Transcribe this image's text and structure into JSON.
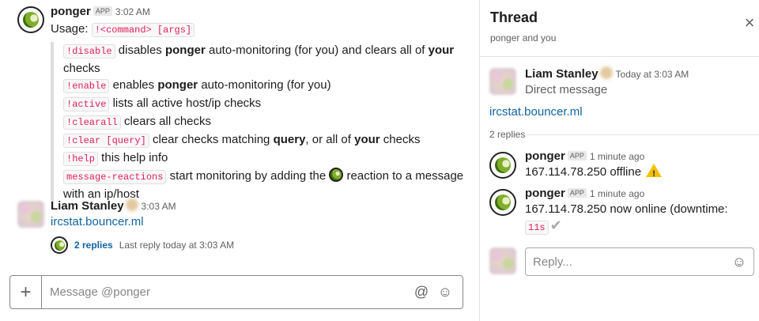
{
  "main": {
    "bot_message": {
      "author": "ponger",
      "badge": "APP",
      "time": "3:02 AM",
      "usage_label": "Usage:",
      "usage_code": "!<command> [args]",
      "commands": [
        {
          "code": "!disable",
          "pre": " disables ",
          "bold1": "ponger",
          "mid": " auto-monitoring (for you) and clears all of ",
          "bold2": "your",
          "post": " checks"
        },
        {
          "code": "!enable",
          "pre": " enables ",
          "bold1": "ponger",
          "mid": " auto-monitoring (for you)",
          "bold2": "",
          "post": ""
        },
        {
          "code": "!active",
          "pre": " lists all active host/ip checks",
          "bold1": "",
          "mid": "",
          "bold2": "",
          "post": ""
        },
        {
          "code": "!clearall",
          "pre": " clears all checks",
          "bold1": "",
          "mid": "",
          "bold2": "",
          "post": ""
        },
        {
          "code": "!clear [query]",
          "pre": " clear checks matching ",
          "bold1": "query",
          "mid": ", or all of ",
          "bold2": "your",
          "post": " checks"
        },
        {
          "code": "!help",
          "pre": " this help info",
          "bold1": "",
          "mid": "",
          "bold2": "",
          "post": ""
        }
      ],
      "reaction_code": "message-reactions",
      "reaction_pre": " start monitoring by adding the ",
      "reaction_post": " reaction to a message with an ip/host"
    },
    "user_message": {
      "author": "Liam Stanley",
      "time": "3:03 AM",
      "link": "ircstat.bouncer.ml"
    },
    "replies": {
      "count_label": "2 replies",
      "last_reply": "Last reply today at 3:03 AM"
    },
    "composer": {
      "plus": "+",
      "placeholder": "Message @ponger",
      "at": "@",
      "emoji": "☺"
    }
  },
  "thread": {
    "title": "Thread",
    "subtitle": "ponger and you",
    "close": "×",
    "parent": {
      "author": "Liam Stanley",
      "time": "Today at 3:03 AM",
      "text": "Direct message",
      "link": "ircstat.bouncer.ml"
    },
    "replies_count": "2 replies",
    "replies": [
      {
        "author": "ponger",
        "badge": "APP",
        "time": "1 minute ago",
        "text": "167.114.78.250 offline"
      },
      {
        "author": "ponger",
        "badge": "APP",
        "time": "1 minute ago",
        "text": "167.114.78.250 now online (downtime:",
        "code": "11s",
        "check": "✔"
      }
    ],
    "reply_placeholder": "Reply...",
    "reply_emoji": "☺"
  }
}
